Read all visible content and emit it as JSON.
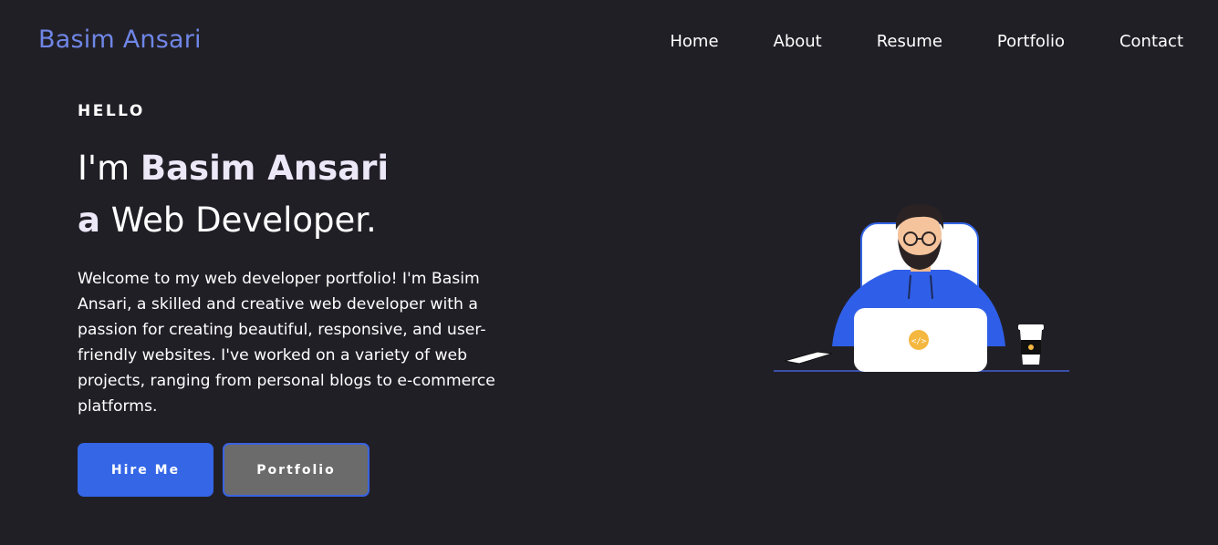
{
  "header": {
    "brand": "Basim Ansari",
    "nav": [
      "Home",
      "About",
      "Resume",
      "Portfolio",
      "Contact"
    ]
  },
  "hero": {
    "greeting": "HELLO",
    "line1_prefix": "I'm ",
    "line1_name": "Basim Ansari",
    "line2_prefix": "a",
    "line2_role": " Web Developer.",
    "intro": "Welcome to my web developer portfolio! I'm Basim Ansari, a skilled and creative web developer with a passion for creating beautiful, responsive, and user-friendly websites. I've worked on a variety of web projects, ranging from personal blogs to e-commerce platforms.",
    "buttons": {
      "hire": "Hire Me",
      "portfolio": "Portfolio"
    }
  },
  "illustration": {
    "icon": "developer-at-laptop-illustration"
  },
  "colors": {
    "background": "#211f26",
    "brand": "#6f86e6",
    "primary": "#3466e6",
    "secondary": "#6b6b6b"
  }
}
